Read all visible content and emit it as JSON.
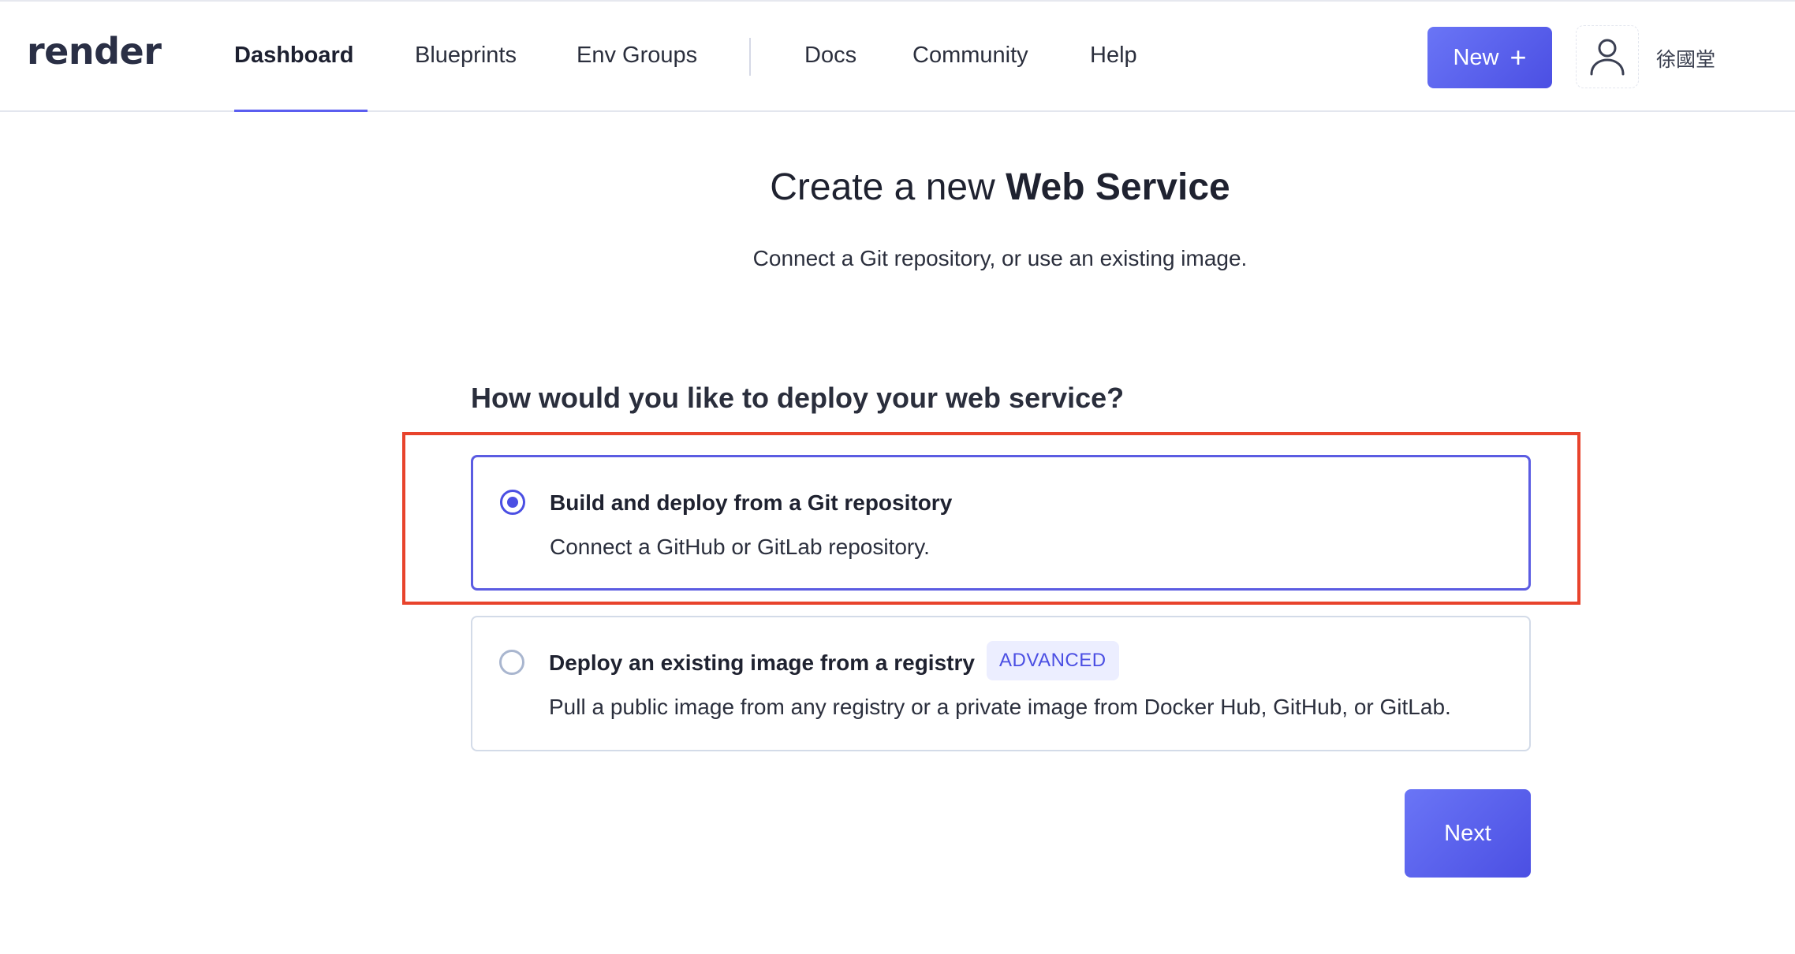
{
  "header": {
    "logo": "render",
    "nav": [
      {
        "label": "Dashboard",
        "active": true
      },
      {
        "label": "Blueprints",
        "active": false
      },
      {
        "label": "Env Groups",
        "active": false
      },
      {
        "label": "Docs",
        "active": false
      },
      {
        "label": "Community",
        "active": false
      },
      {
        "label": "Help",
        "active": false
      }
    ],
    "new_button": {
      "label": "New",
      "icon": "plus-icon"
    },
    "avatar_icon": "user-icon",
    "username": "徐國堂"
  },
  "main": {
    "title_prefix": "Create a new",
    "title_bold": "Web Service",
    "subtitle": "Connect a Git repository, or use an existing image.",
    "question": "How would you like to deploy your web service?",
    "options": [
      {
        "title": "Build and deploy from a Git repository",
        "description": "Connect a GitHub or GitLab repository.",
        "selected": true
      },
      {
        "title": "Deploy an existing image from a registry",
        "badge": "ADVANCED",
        "description": "Pull a public image from any registry or a private image from Docker Hub, GitHub, or GitLab.",
        "selected": false
      }
    ],
    "next_button": "Next"
  },
  "colors": {
    "accent": "#4b4fe3",
    "highlight": "#e8432c",
    "border": "#d3dbe8"
  }
}
